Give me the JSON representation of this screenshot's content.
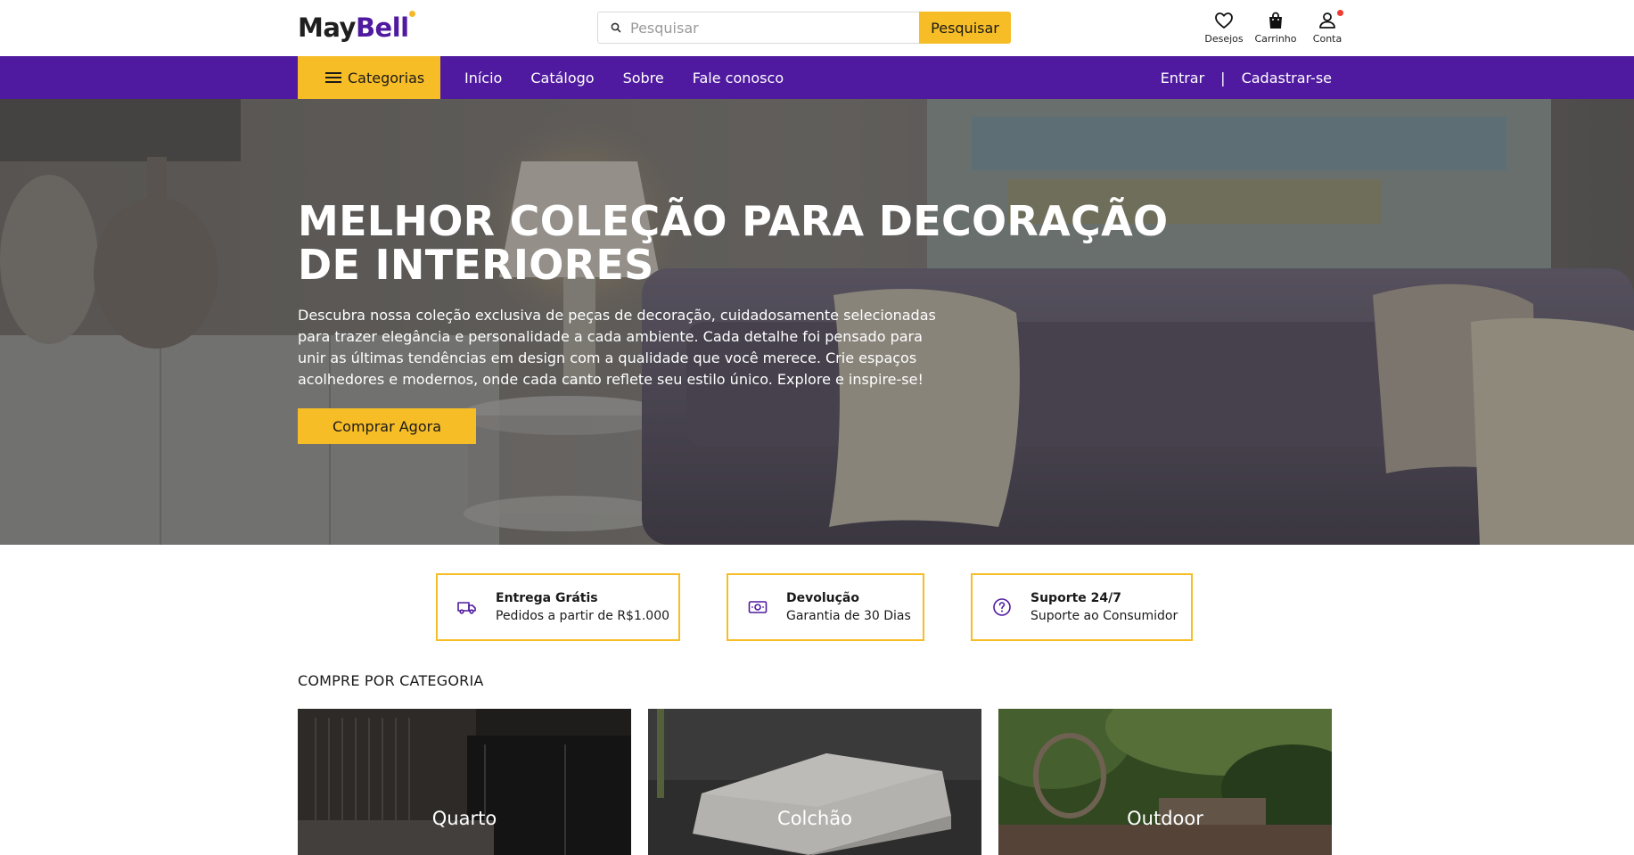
{
  "header": {
    "logo_part1": "May",
    "logo_part2": "Bell",
    "search_placeholder": "Pesquisar",
    "search_button": "Pesquisar",
    "icons": [
      {
        "label": "Desejos",
        "icon": "heart-icon"
      },
      {
        "label": "Carrinho",
        "icon": "bag-icon"
      },
      {
        "label": "Conta",
        "icon": "user-icon",
        "badge": true
      }
    ]
  },
  "nav": {
    "categories_button": "Categorias",
    "links": [
      "Início",
      "Catálogo",
      "Sobre",
      "Fale conosco"
    ],
    "login": "Entrar",
    "separator": "|",
    "register": "Cadastrar-se"
  },
  "hero": {
    "title": "MELHOR COLEÇÃO PARA DECORAÇÃO DE INTERIORES",
    "text": "Descubra nossa coleção exclusiva de peças de decoração, cuidadosamente selecionadas para trazer elegância e personalidade a cada ambiente. Cada detalhe foi pensado para unir as últimas tendências em design com a qualidade que você merece. Crie espaços acolhedores e modernos, onde cada canto reflete seu estilo único. Explore e inspire-se!",
    "button": "Comprar Agora"
  },
  "features": [
    {
      "title": "Entrega Grátis",
      "subtitle": "Pedidos a partir de R$1.000",
      "icon": "truck-icon"
    },
    {
      "title": "Devolução",
      "subtitle": "Garantia de 30 Dias",
      "icon": "money-icon"
    },
    {
      "title": "Suporte 24/7",
      "subtitle": "Suporte ao Consumidor",
      "icon": "question-icon"
    }
  ],
  "categories": {
    "title": "COMPRE POR CATEGORIA",
    "items": [
      "Quarto",
      "Colchão",
      "Outdoor"
    ]
  },
  "colors": {
    "primary": "#4f1aa0",
    "accent": "#f7bd26",
    "badge": "#ee3b33"
  }
}
